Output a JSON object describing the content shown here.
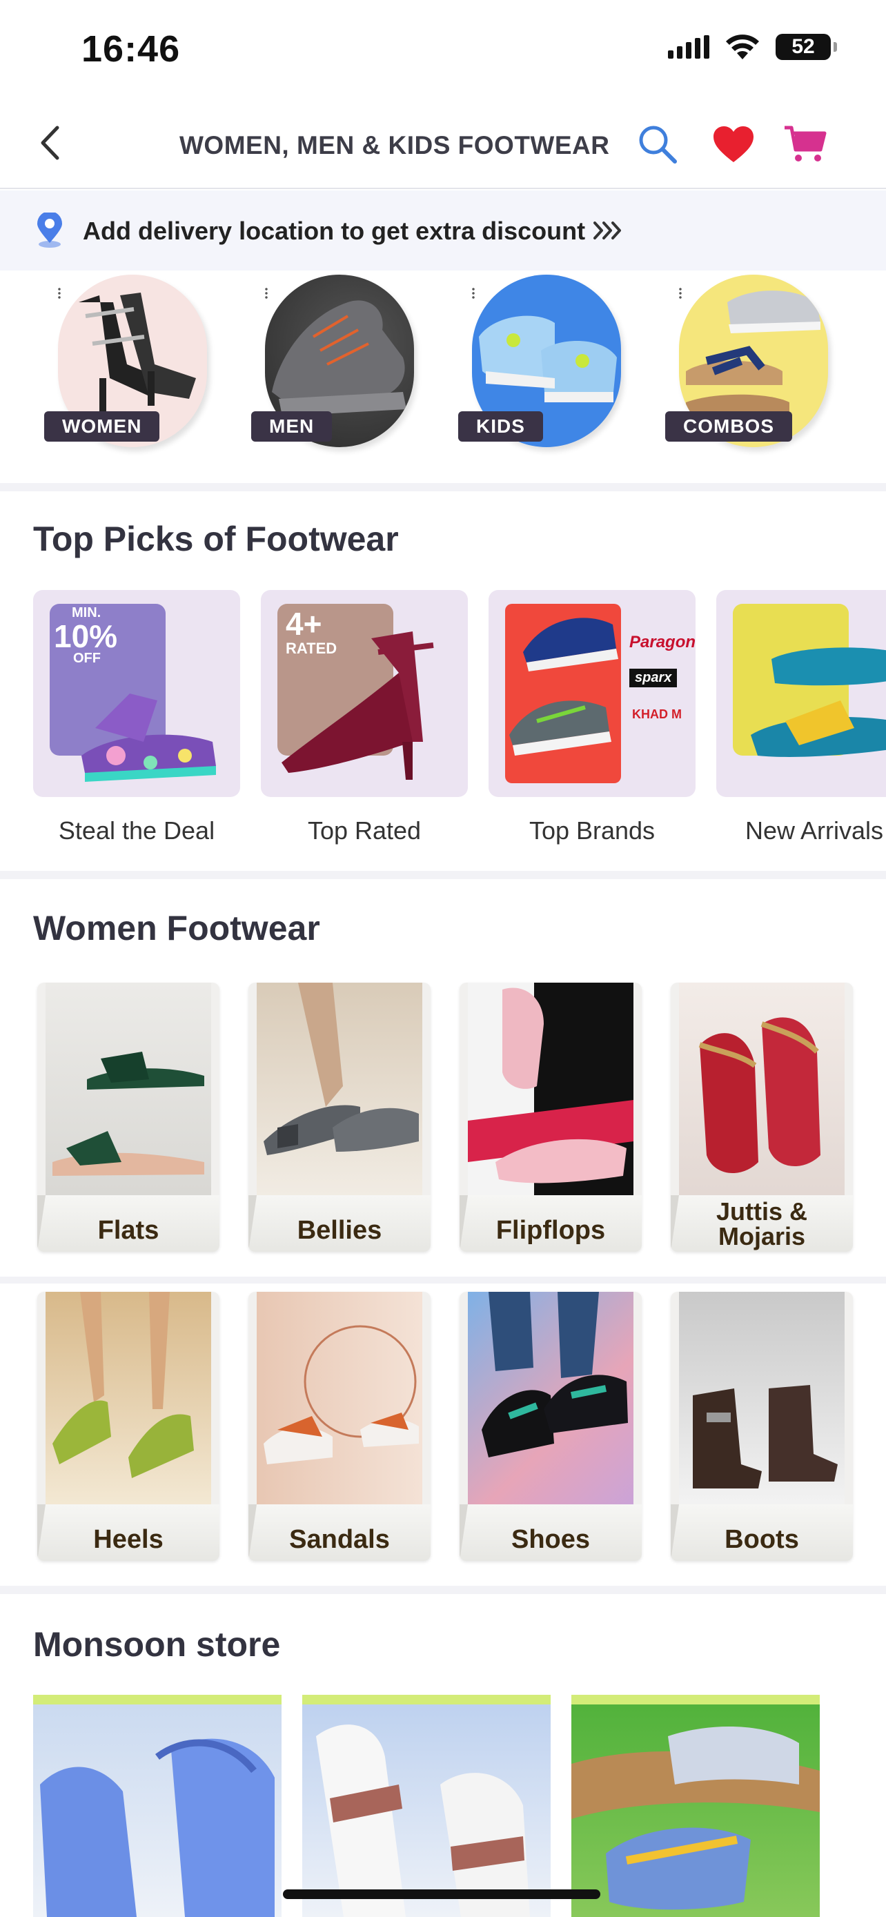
{
  "status_bar": {
    "time": "16:46",
    "battery": "52"
  },
  "header": {
    "title": "WOMEN, MEN & KIDS FOOTWEAR"
  },
  "delivery": {
    "text": "Add delivery location to get extra discount"
  },
  "categories": [
    {
      "label": "WOMEN"
    },
    {
      "label": "MEN"
    },
    {
      "label": "KIDS"
    },
    {
      "label": "COMBOS"
    }
  ],
  "top_picks": {
    "title": "Top Picks of Footwear",
    "items": [
      {
        "label": "Steal the Deal",
        "badge_top": "MIN.",
        "badge_main": "10%",
        "badge_bottom": "OFF"
      },
      {
        "label": "Top Rated",
        "badge_main": "4+",
        "badge_bottom": "RATED"
      },
      {
        "label": "Top Brands",
        "brands": [
          "Paragon",
          "sparx",
          "KHAD M"
        ]
      },
      {
        "label": "New Arrivals"
      }
    ]
  },
  "women_footwear": {
    "title": "Women Footwear",
    "items": [
      {
        "label": "Flats"
      },
      {
        "label": "Bellies"
      },
      {
        "label": "Flipflops"
      },
      {
        "label_line1": "Juttis &",
        "label_line2": "Mojaris"
      },
      {
        "label": "Heels"
      },
      {
        "label": "Sandals"
      },
      {
        "label": "Shoes"
      },
      {
        "label": "Boots"
      }
    ]
  },
  "monsoon": {
    "title": "Monsoon store"
  },
  "colors": {
    "search": "#3f7fdc",
    "heart": "#e8202f",
    "cart": "#d6318f",
    "tile_text": "#3b2a12"
  }
}
